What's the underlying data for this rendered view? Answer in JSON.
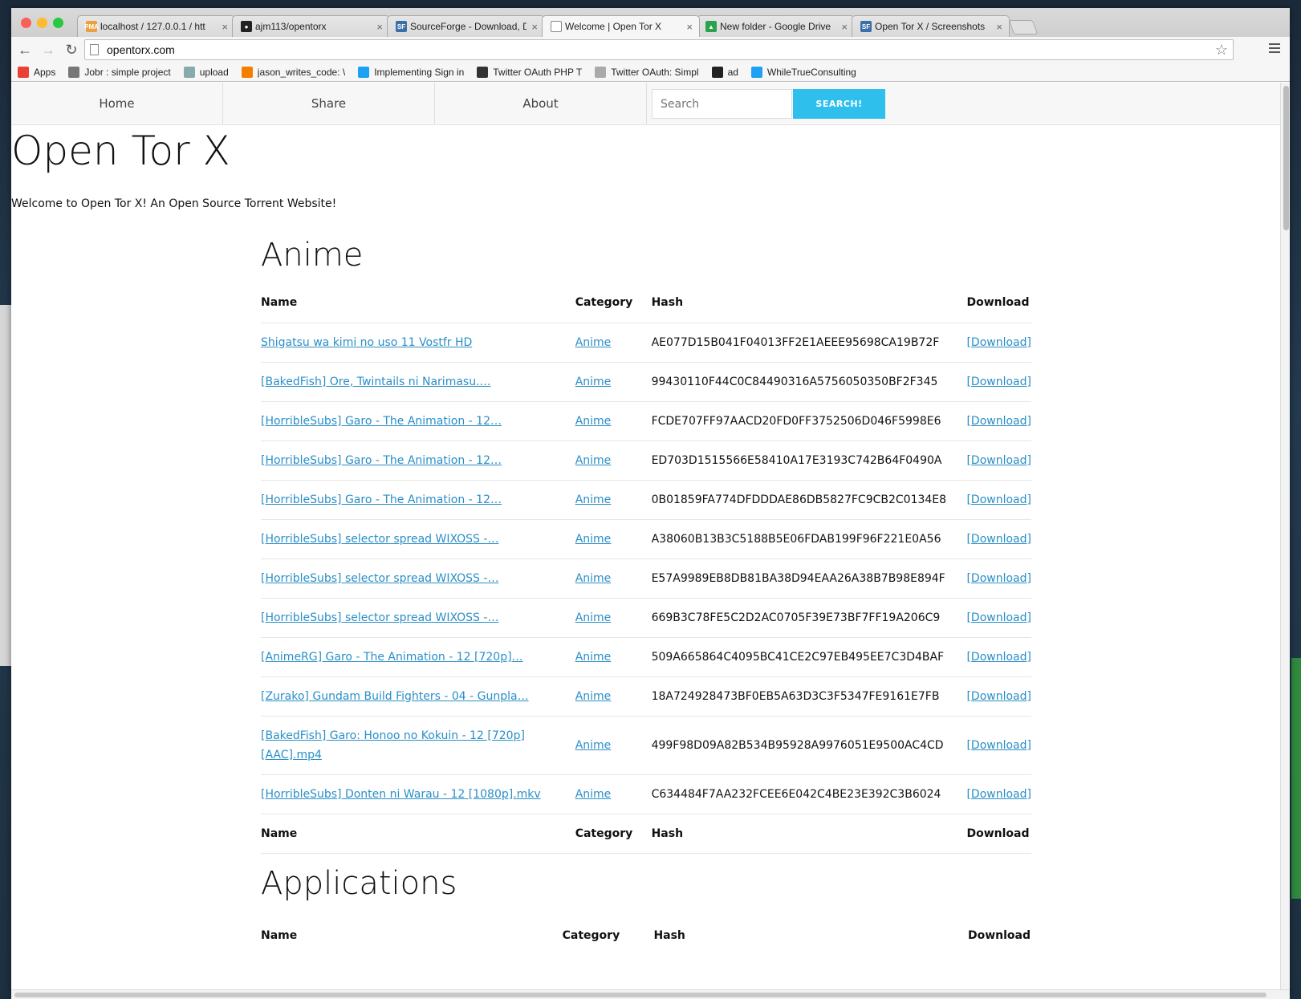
{
  "browser": {
    "tabs": [
      {
        "title": "localhost / 127.0.0.1 / htt",
        "favicon": "pma-icon",
        "active": false
      },
      {
        "title": "ajm113/opentorx",
        "favicon": "github-icon",
        "active": false
      },
      {
        "title": "SourceForge - Download, D",
        "favicon": "sourceforge-icon",
        "active": false
      },
      {
        "title": "Welcome | Open Tor X",
        "favicon": "page-icon",
        "active": true
      },
      {
        "title": "New folder - Google Drive",
        "favicon": "drive-icon",
        "active": false
      },
      {
        "title": "Open Tor X / Screenshots",
        "favicon": "sourceforge-icon",
        "active": false
      }
    ],
    "url": "opentorx.com",
    "bookmarks": [
      {
        "label": "Apps",
        "icon": "apps-grid-icon"
      },
      {
        "label": "Jobr : simple project",
        "icon": "jobr-icon"
      },
      {
        "label": "upload",
        "icon": "cube-icon"
      },
      {
        "label": "jason_writes_code: \\",
        "icon": "blogger-icon"
      },
      {
        "label": "Implementing Sign in",
        "icon": "twitter-icon"
      },
      {
        "label": "Twitter OAuth PHP T",
        "icon": "site-icon"
      },
      {
        "label": "Twitter OAuth: Simpl",
        "icon": "lines-icon"
      },
      {
        "label": "ad",
        "icon": "github-icon"
      },
      {
        "label": "WhileTrueConsulting",
        "icon": "twitter-icon"
      }
    ]
  },
  "site": {
    "nav": [
      "Home",
      "Share",
      "About"
    ],
    "search_placeholder": "Search",
    "search_button": "SEARCH!",
    "title": "Open Tor X",
    "welcome": "Welcome to Open Tor X! An Open Source Torrent Website!"
  },
  "anime": {
    "heading": "Anime",
    "columns": [
      "Name",
      "Category",
      "Hash",
      "Download"
    ],
    "rows": [
      {
        "name": "Shigatsu wa kimi no uso 11 Vostfr HD",
        "category": "Anime",
        "hash": "AE077D15B041F04013FF2E1AEEE95698CA19B72F",
        "download": "[Download]"
      },
      {
        "name": "[BakedFish] Ore, Twintails ni Narimasu.…",
        "category": "Anime",
        "hash": "99430110F44C0C84490316A5756050350BF2F345",
        "download": "[Download]"
      },
      {
        "name": "[HorribleSubs] Garo - The Animation - 12…",
        "category": "Anime",
        "hash": "FCDE707FF97AACD20FD0FF3752506D046F5998E6",
        "download": "[Download]"
      },
      {
        "name": "[HorribleSubs] Garo - The Animation - 12…",
        "category": "Anime",
        "hash": "ED703D1515566E58410A17E3193C742B64F0490A",
        "download": "[Download]"
      },
      {
        "name": "[HorribleSubs] Garo - The Animation - 12…",
        "category": "Anime",
        "hash": "0B01859FA774DFDDDAE86DB5827FC9CB2C0134E8",
        "download": "[Download]"
      },
      {
        "name": "[HorribleSubs] selector spread WIXOSS -…",
        "category": "Anime",
        "hash": "A38060B13B3C5188B5E06FDAB199F96F221E0A56",
        "download": "[Download]"
      },
      {
        "name": "[HorribleSubs] selector spread WIXOSS -…",
        "category": "Anime",
        "hash": "E57A9989EB8DB81BA38D94EAA26A38B7B98E894F",
        "download": "[Download]"
      },
      {
        "name": "[HorribleSubs] selector spread WIXOSS -…",
        "category": "Anime",
        "hash": "669B3C78FE5C2D2AC0705F39E73BF7FF19A206C9",
        "download": "[Download]"
      },
      {
        "name": "[AnimeRG] Garo - The Animation - 12 [720p]…",
        "category": "Anime",
        "hash": "509A665864C4095BC41CE2C97EB495EE7C3D4BAF",
        "download": "[Download]"
      },
      {
        "name": "[Zurako] Gundam Build Fighters - 04 - Gunpla…",
        "category": "Anime",
        "hash": "18A724928473BF0EB5A63D3C3F5347FE9161E7FB",
        "download": "[Download]"
      },
      {
        "name": "[BakedFish] Garo: Honoo no Kokuin - 12 [720p][AAC].mp4",
        "category": "Anime",
        "hash": "499F98D09A82B534B95928A9976051E9500AC4CD",
        "download": "[Download]"
      },
      {
        "name": "[HorribleSubs] Donten ni Warau - 12 [1080p].mkv",
        "category": "Anime",
        "hash": "C634484F7AA232FCEE6E042C4BE23E392C3B6024",
        "download": "[Download]"
      }
    ]
  },
  "applications": {
    "heading": "Applications",
    "columns": [
      "Name",
      "Category",
      "Hash",
      "Download"
    ]
  },
  "colors": {
    "accent": "#2ebfed",
    "link": "#2a8fc7"
  }
}
